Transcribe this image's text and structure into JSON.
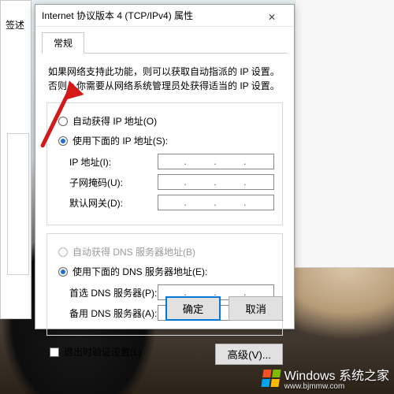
{
  "behind": {
    "label": "签述"
  },
  "dialog": {
    "title": "Internet 协议版本 4 (TCP/IPv4) 属性",
    "close": "✕",
    "tab": "常规",
    "description": "如果网络支持此功能，则可以获取自动指派的 IP 设置。否则，你需要从网络系统管理员处获得适当的 IP 设置。",
    "ip": {
      "auto": "自动获得 IP 地址(O)",
      "manual": "使用下面的 IP 地址(S):",
      "fields": {
        "ip": "IP 地址(I):",
        "mask": "子网掩码(U):",
        "gateway": "默认网关(D):"
      }
    },
    "dns": {
      "auto": "自动获得 DNS 服务器地址(B)",
      "manual": "使用下面的 DNS 服务器地址(E):",
      "fields": {
        "primary": "首选 DNS 服务器(P):",
        "alt": "备用 DNS 服务器(A):"
      }
    },
    "validate": "退出时验证设置(L)",
    "advanced": "高级(V)...",
    "ok": "确定",
    "cancel": "取消"
  },
  "watermark": {
    "main": "Windows 系统之家",
    "sub": "www.bjmmw.com"
  }
}
